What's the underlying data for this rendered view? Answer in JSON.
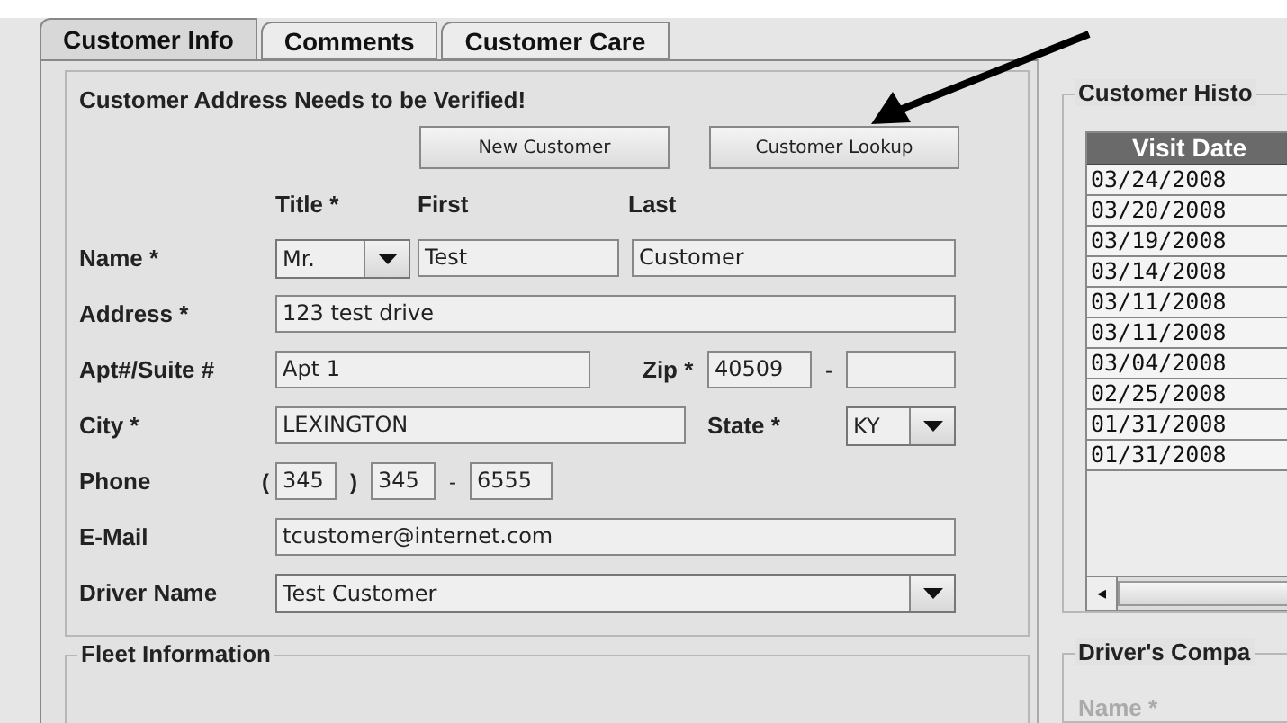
{
  "tabs": [
    {
      "label": "Customer Info",
      "selected": true
    },
    {
      "label": "Comments",
      "selected": false
    },
    {
      "label": "Customer Care",
      "selected": false
    }
  ],
  "address_section": {
    "heading": "Customer Address Needs to be Verified!",
    "buttons": [
      "New Customer",
      "Customer Lookup"
    ],
    "column_headers": [
      "Title *",
      "First",
      "Last"
    ],
    "name": {
      "label": "Name *",
      "title": "Mr.",
      "first": "Test",
      "last": "Customer"
    },
    "address": {
      "label": "Address *",
      "value": "123 test drive"
    },
    "apt": {
      "label": "Apt#/Suite #",
      "value": "Apt 1"
    },
    "zip": {
      "label": "Zip *",
      "value": "40509",
      "separator": "-"
    },
    "city": {
      "label": "City *",
      "value": "LEXINGTON"
    },
    "state": {
      "label": "State *",
      "value": "KY"
    },
    "phone": {
      "label": "Phone",
      "open": "(",
      "area": "345",
      "close": ")",
      "prefix": "345",
      "separator": "-",
      "line": "6555"
    },
    "email": {
      "label": "E-Mail",
      "value": "tcustomer@internet.com"
    },
    "driver": {
      "label": "Driver Name",
      "value": "Test Customer"
    }
  },
  "fleet_section": {
    "title": "Fleet Information"
  },
  "history_section": {
    "title": "Customer Histo",
    "columns": [
      "Visit Date"
    ],
    "rows": [
      "03/24/2008",
      "03/20/2008",
      "03/19/2008",
      "03/14/2008",
      "03/11/2008",
      "03/11/2008",
      "03/04/2008",
      "02/25/2008",
      "01/31/2008",
      "01/31/2008"
    ],
    "scroll_left": "◂"
  },
  "driver_company_section": {
    "title": "Driver's Compa",
    "fields": [
      {
        "label": "Name *",
        "disabled": true
      }
    ]
  }
}
